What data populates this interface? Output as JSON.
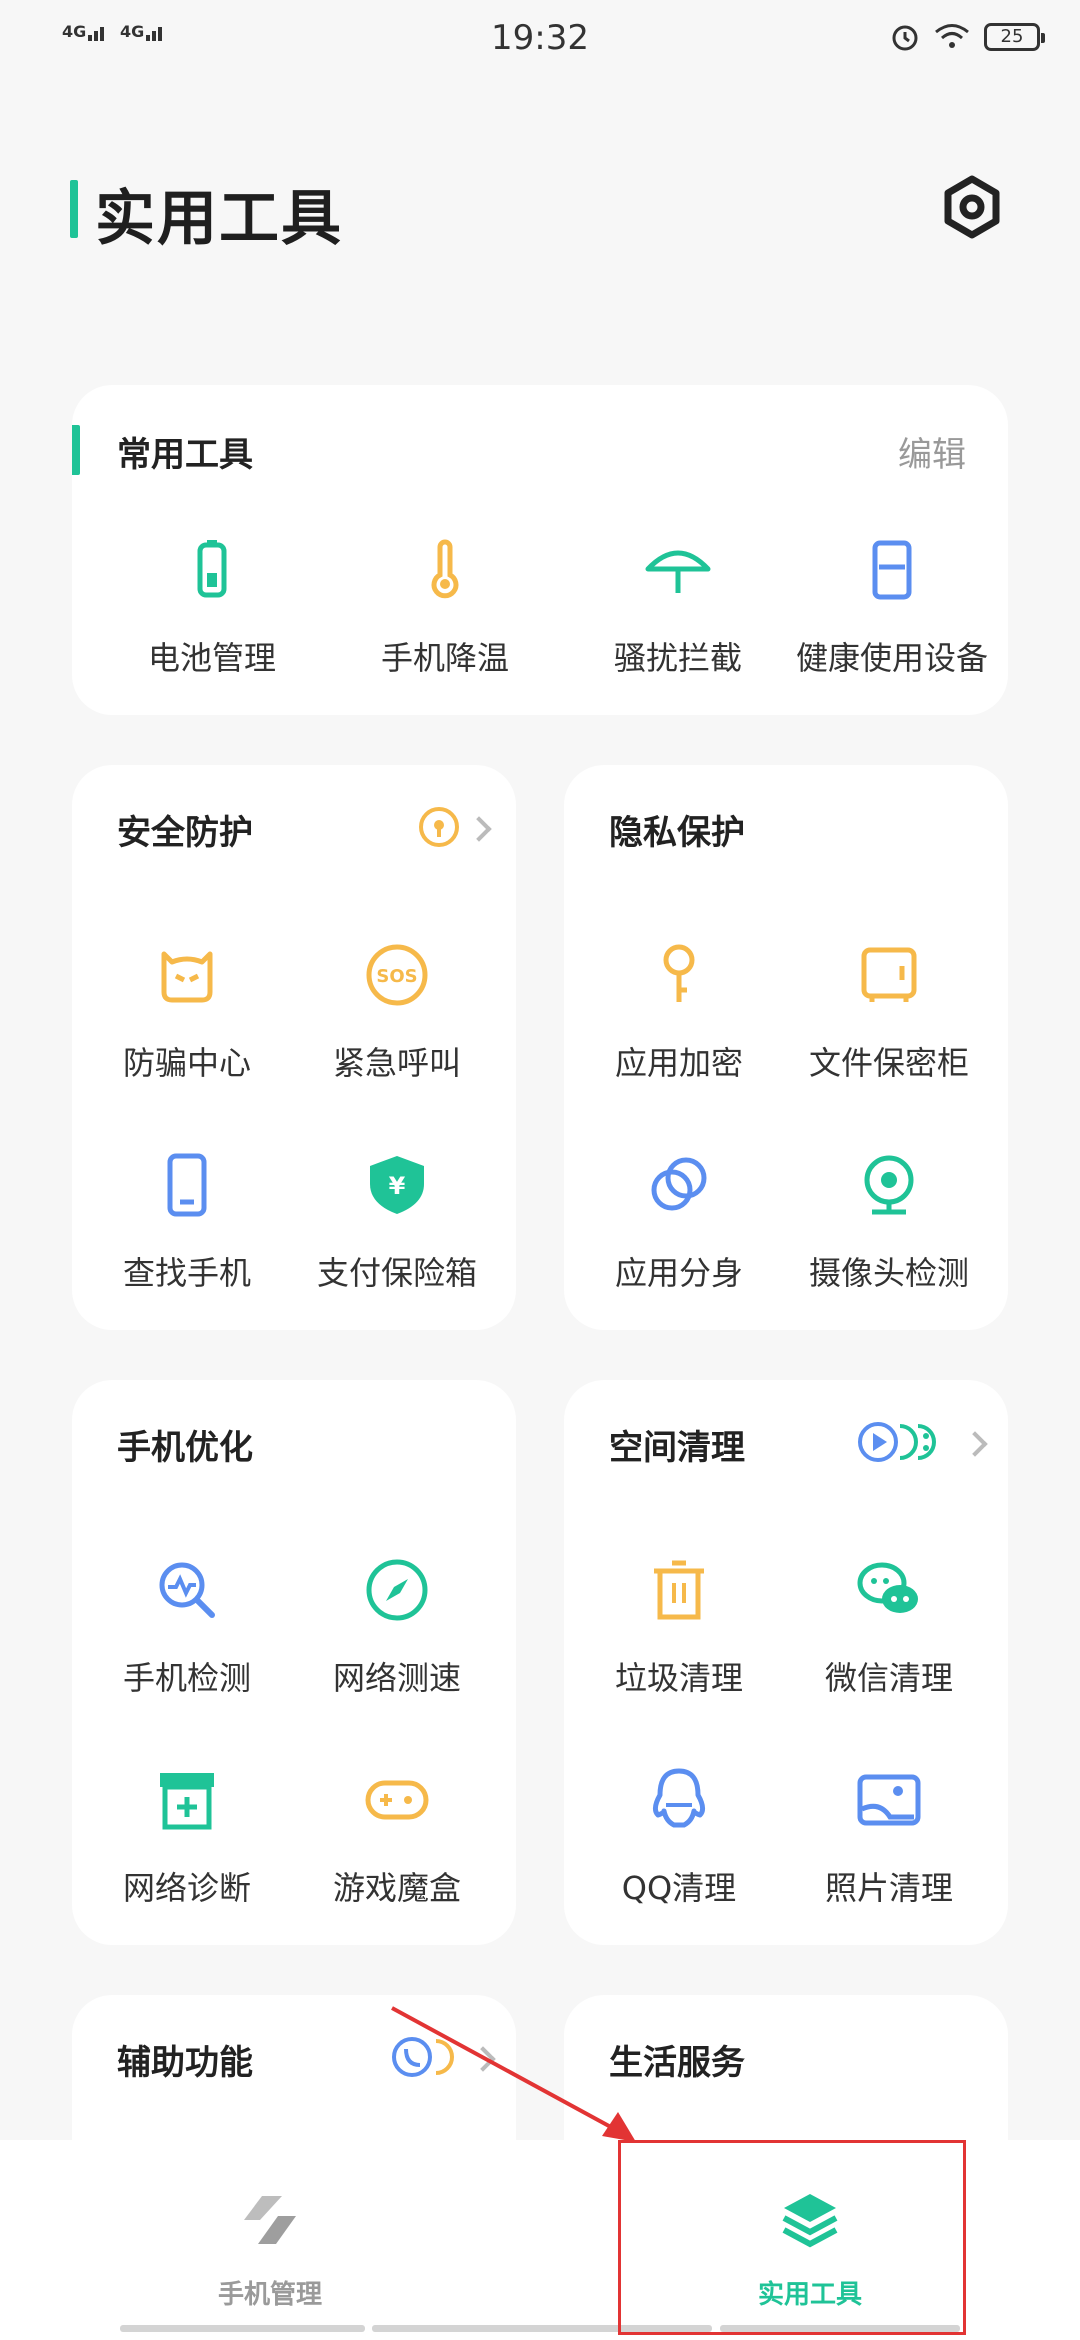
{
  "status_bar": {
    "sim1": "4G",
    "sim2": "4G",
    "time": "19:32",
    "battery": "25"
  },
  "header": {
    "title": "实用工具"
  },
  "common_tools": {
    "title": "常用工具",
    "edit_label": "编辑",
    "items": [
      {
        "label": "电池管理",
        "icon": "battery-icon"
      },
      {
        "label": "手机降温",
        "icon": "thermometer-icon"
      },
      {
        "label": "骚扰拦截",
        "icon": "umbrella-icon"
      },
      {
        "label": "健康使用设备",
        "icon": "hourglass-icon"
      }
    ]
  },
  "security": {
    "title": "安全防护",
    "items": [
      {
        "label": "防骗中心",
        "icon": "anti-fraud-icon"
      },
      {
        "label": "紧急呼叫",
        "icon": "sos-icon"
      },
      {
        "label": "查找手机",
        "icon": "phone-icon"
      },
      {
        "label": "支付保险箱",
        "icon": "payment-shield-icon"
      }
    ]
  },
  "privacy": {
    "title": "隐私保护",
    "items": [
      {
        "label": "应用加密",
        "icon": "key-icon"
      },
      {
        "label": "文件保密柜",
        "icon": "safe-icon"
      },
      {
        "label": "应用分身",
        "icon": "clone-icon"
      },
      {
        "label": "摄像头检测",
        "icon": "camera-icon"
      }
    ]
  },
  "optimize": {
    "title": "手机优化",
    "items": [
      {
        "label": "手机检测",
        "icon": "search-check-icon"
      },
      {
        "label": "网络测速",
        "icon": "compass-icon"
      },
      {
        "label": "网络诊断",
        "icon": "network-diagnose-icon"
      },
      {
        "label": "游戏魔盒",
        "icon": "gamepad-icon"
      }
    ]
  },
  "storage": {
    "title": "空间清理",
    "items": [
      {
        "label": "垃圾清理",
        "icon": "trash-icon"
      },
      {
        "label": "微信清理",
        "icon": "wechat-icon"
      },
      {
        "label": "QQ清理",
        "icon": "qq-icon"
      },
      {
        "label": "照片清理",
        "icon": "photo-icon"
      }
    ]
  },
  "assist": {
    "title": "辅助功能"
  },
  "life": {
    "title": "生活服务"
  },
  "nav": {
    "manage_label": "手机管理",
    "tools_label": "实用工具"
  },
  "colors": {
    "accent": "#1fc397",
    "orange": "#f6b94a",
    "blue": "#5b8ef0",
    "highlight": "#e23434"
  }
}
